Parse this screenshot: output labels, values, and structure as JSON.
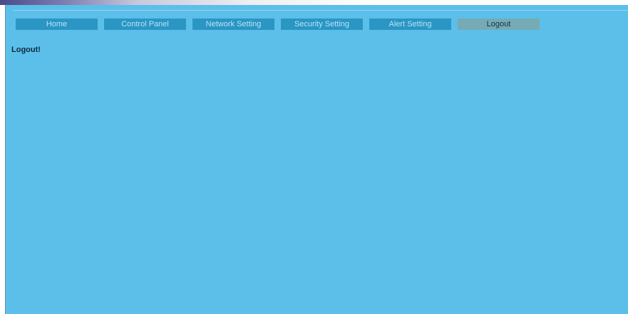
{
  "nav": {
    "items": [
      {
        "label": "Home"
      },
      {
        "label": "Control Panel"
      },
      {
        "label": "Network Setting"
      },
      {
        "label": "Security Setting"
      },
      {
        "label": "Alert Setting"
      },
      {
        "label": "Logout"
      }
    ],
    "active_index": 5
  },
  "main": {
    "message": "Logout!"
  },
  "colors": {
    "content_background": "#5bbfe9",
    "nav_button": "#2b96c4",
    "nav_button_active": "#76aab4",
    "nav_text": "#b7e3f5",
    "nav_text_active": "#12324a"
  }
}
